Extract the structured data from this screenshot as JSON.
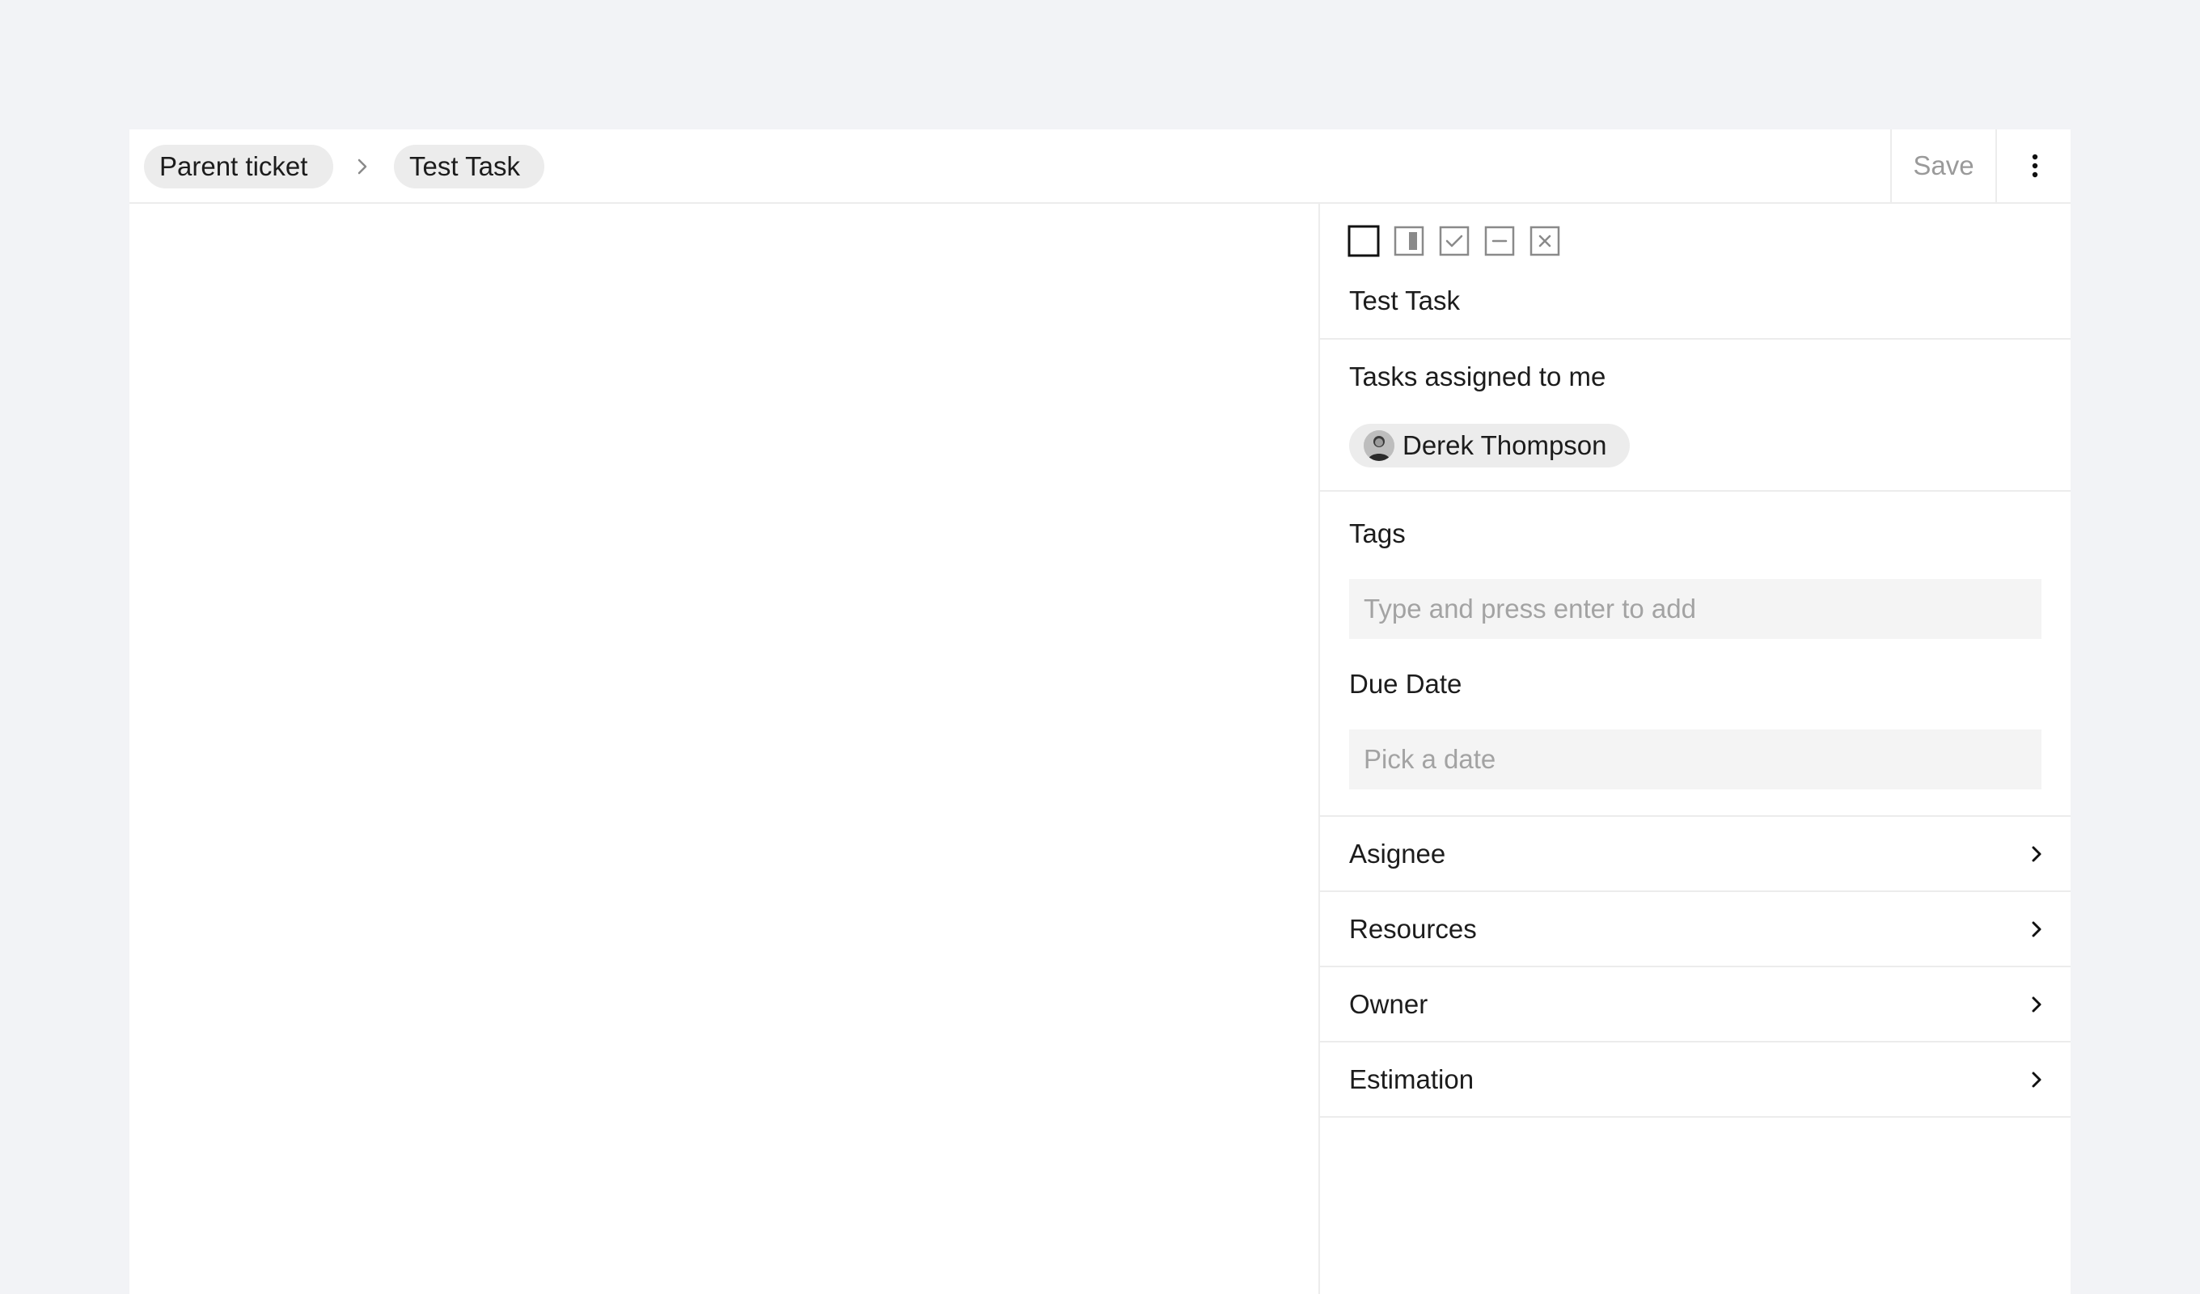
{
  "breadcrumb": {
    "parent_label": "Parent ticket",
    "current_label": "Test Task"
  },
  "header": {
    "save_label": "Save"
  },
  "panel": {
    "status_icons": [
      "status-open-icon",
      "status-in-progress-icon",
      "status-done-icon",
      "status-blocked-icon",
      "status-cancelled-icon"
    ],
    "task_title": "Test Task",
    "assigned_label": "Tasks assigned to me",
    "assigned_user": "Derek Thompson",
    "tags_label": "Tags",
    "tags_placeholder": "Type and press enter to add",
    "due_date_label": "Due Date",
    "due_date_placeholder": "Pick a date",
    "rows": [
      {
        "label": "Asignee"
      },
      {
        "label": "Resources"
      },
      {
        "label": "Owner"
      },
      {
        "label": "Estimation"
      }
    ]
  },
  "colors": {
    "page_background": "#f2f3f6",
    "chip_background": "#ececec",
    "input_background": "#f4f4f4",
    "muted_text": "#9a9a9a"
  }
}
